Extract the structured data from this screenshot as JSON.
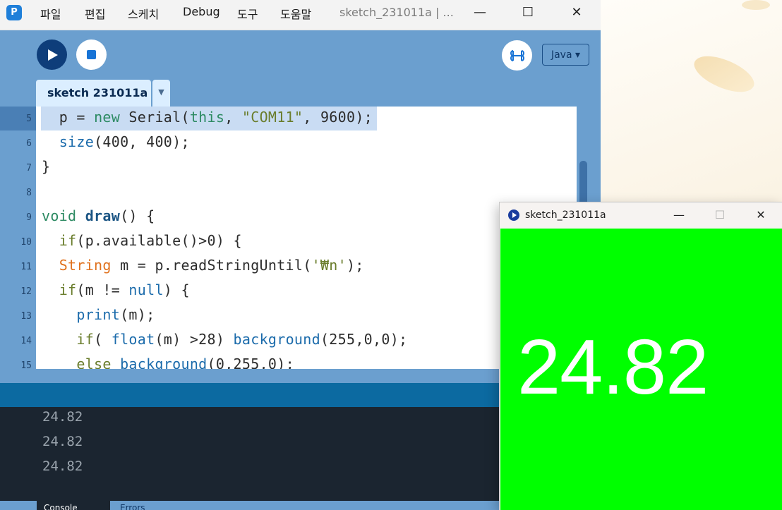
{
  "desktop": {
    "accent": "#f3d9a6"
  },
  "ide": {
    "menu": [
      "파일",
      "편집",
      "스케치",
      "Debug",
      "도구",
      "도움말"
    ],
    "window_title": "sketch_231011a | ...",
    "controls": {
      "minimize": "—",
      "maximize": "☐",
      "close": "✕"
    },
    "toolbar": {
      "run_icon": "play-icon",
      "stop_icon": "stop-icon",
      "debugger_icon": "debugger-icon",
      "mode_label": "Java ▾"
    },
    "tab": {
      "label": "sketch 231011a",
      "menu_arrow": "▼"
    },
    "line_numbers": [
      "5",
      "6",
      "7",
      "8",
      "9",
      "10",
      "11",
      "12",
      "13",
      "14",
      "15"
    ],
    "code": {
      "l5": {
        "indent": "  ",
        "a": "p = ",
        "kw1": "new",
        "b": " Serial(",
        "kw2": "this",
        "c": ", ",
        "s": "\"COM11\"",
        "d": ", 9600);"
      },
      "l6": {
        "indent": "  ",
        "fn": "size",
        "rest": "(400, 400);"
      },
      "l7": {
        "text": "}"
      },
      "l9": {
        "kw": "void",
        "sp": " ",
        "fn": "draw",
        "rest": "() {"
      },
      "l10": {
        "indent": "  ",
        "kw": "if",
        "rest": "(p.available()>0) {"
      },
      "l11": {
        "indent": "  ",
        "type": "String",
        "a": " m = p.readStringUntil(",
        "s": "'₩n'",
        "b": ");"
      },
      "l12": {
        "indent": "  ",
        "kw": "if",
        "a": "(m != ",
        "kw2": "null",
        "b": ") {"
      },
      "l13": {
        "indent": "    ",
        "fn": "print",
        "rest": "(m);"
      },
      "l14": {
        "indent": "    ",
        "kw": "if",
        "a": "( ",
        "kw2": "float",
        "b": "(m) >28) ",
        "fn": "background",
        "c": "(255,0,0);"
      },
      "l15": {
        "indent": "    ",
        "kw": "else",
        "sp": " ",
        "fn": "background",
        "rest": "(0,255,0);"
      }
    },
    "console_lines": [
      "24.82",
      "24.82",
      "24.82"
    ],
    "console_tab": "Console",
    "errors_tab": "Errors"
  },
  "sketch_window": {
    "title": "sketch_231011a",
    "canvas_color": "#00ff00",
    "value": "24.82",
    "controls": {
      "minimize": "—",
      "maximize": "☐",
      "close": "✕"
    }
  }
}
